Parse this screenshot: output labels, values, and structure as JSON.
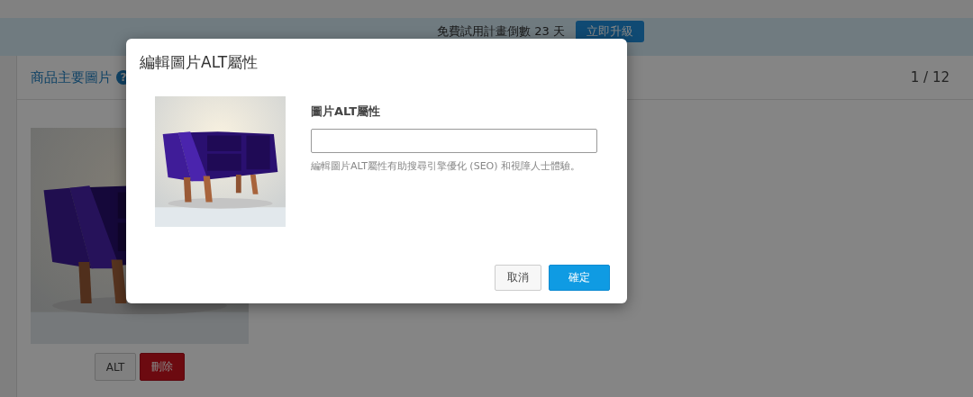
{
  "trial_banner": {
    "message": "免費試用計畫倒數 23 天",
    "upgrade_button": "立即升級"
  },
  "section": {
    "title": "商品主要圖片",
    "help_mark": "?",
    "counter": "1 / 12",
    "image_buttons": [
      {
        "label": "ALT",
        "kind": "default"
      },
      {
        "label": "刪除",
        "kind": "danger"
      }
    ]
  },
  "modal": {
    "title": "編輯圖片ALT屬性",
    "field_label": "圖片ALT屬性",
    "help_text": "編輯圖片ALT屬性有助搜尋引擎優化 (SEO) 和視障人士體驗。",
    "buttons": [
      {
        "label": "取消",
        "kind": "secondary"
      },
      {
        "label": "確定",
        "kind": "primary"
      }
    ]
  }
}
